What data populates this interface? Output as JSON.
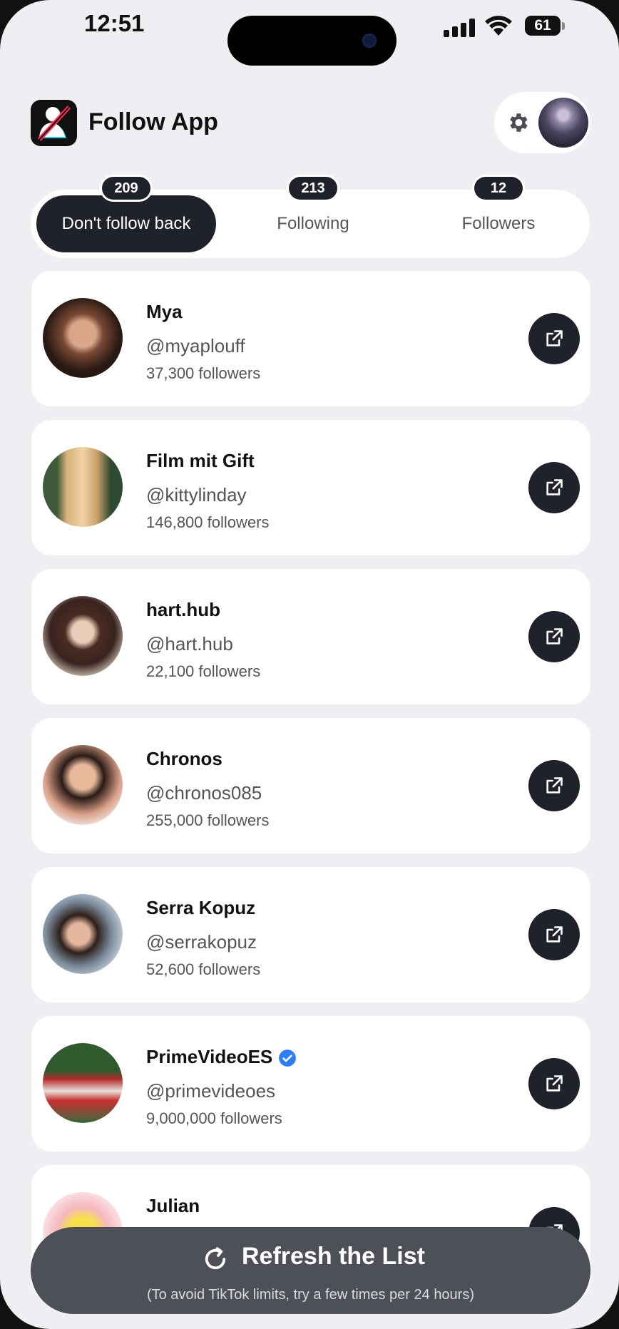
{
  "status_bar": {
    "time": "12:51",
    "battery": "61"
  },
  "header": {
    "app_name": "Follow App"
  },
  "tabs": [
    {
      "label": "Don't follow back",
      "count": "209",
      "active": true
    },
    {
      "label": "Following",
      "count": "213",
      "active": false
    },
    {
      "label": "Followers",
      "count": "12",
      "active": false
    }
  ],
  "accounts": [
    {
      "name": "Mya",
      "handle": "@myaplouff",
      "followers": "37,300 followers",
      "verified": false
    },
    {
      "name": "Film mit Gift",
      "handle": "@kittylinday",
      "followers": "146,800 followers",
      "verified": false
    },
    {
      "name": "hart.hub",
      "handle": "@hart.hub",
      "followers": "22,100 followers",
      "verified": false
    },
    {
      "name": "Chronos",
      "handle": "@chronos085",
      "followers": "255,000 followers",
      "verified": false
    },
    {
      "name": "Serra Kopuz",
      "handle": "@serrakopuz",
      "followers": "52,600 followers",
      "verified": false
    },
    {
      "name": "PrimeVideoES",
      "handle": "@primevideoes",
      "followers": "9,000,000 followers",
      "verified": true
    },
    {
      "name": "Julian",
      "handle": "",
      "followers": "",
      "verified": false
    }
  ],
  "refresh": {
    "label": "Refresh the List",
    "note": "(To avoid TikTok limits, try a few times per 24 hours)"
  },
  "colors": {
    "background": "#eeeff2",
    "dark": "#1f222a",
    "verified": "#2f7ef5",
    "refresh_button": "#4e5057"
  },
  "icons": [
    "gear-icon",
    "external-link-icon",
    "verified-badge-icon",
    "refresh-icon"
  ]
}
